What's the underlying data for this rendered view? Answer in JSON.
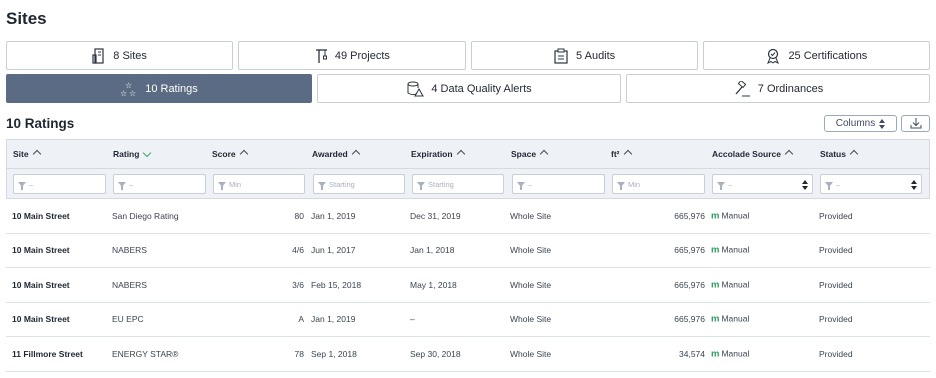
{
  "page": {
    "title": "Sites"
  },
  "tabs_row1": [
    {
      "label": "8 Sites",
      "icon": "building-icon"
    },
    {
      "label": "49 Projects",
      "icon": "crane-icon"
    },
    {
      "label": "5 Audits",
      "icon": "clipboard-icon"
    },
    {
      "label": "25 Certifications",
      "icon": "ribbon-badge-icon"
    }
  ],
  "tabs_row2": [
    {
      "label": "10 Ratings",
      "icon": "stars-icon",
      "active": true
    },
    {
      "label": "4 Data Quality Alerts",
      "icon": "database-alert-icon"
    },
    {
      "label": "7 Ordinances",
      "icon": "gavel-icon"
    }
  ],
  "section": {
    "title": "10 Ratings",
    "columns_label": "Columns"
  },
  "table": {
    "headers": [
      "Site",
      "Rating",
      "Score",
      "Awarded",
      "Expiration",
      "Space",
      "ft²",
      "Accolade Source",
      "Status"
    ],
    "filters": {
      "site": "–",
      "rating": "–",
      "score": "Min",
      "awarded": "Starting",
      "expiration": "Starting",
      "space": "–",
      "ft2": "Min",
      "accolade_source": "–",
      "status": "–"
    },
    "rows": [
      {
        "site": "10 Main Street",
        "rating": "San Diego Rating",
        "score": "80",
        "awarded": "Jan 1, 2019",
        "expiration": "Dec 31, 2019",
        "space": "Whole Site",
        "ft2": "665,976",
        "source": "Manual",
        "status": "Provided"
      },
      {
        "site": "10 Main Street",
        "rating": "NABERS",
        "score": "4/6",
        "awarded": "Jun 1, 2017",
        "expiration": "Jan 1, 2018",
        "space": "Whole Site",
        "ft2": "665,976",
        "source": "Manual",
        "status": "Provided"
      },
      {
        "site": "10 Main Street",
        "rating": "NABERS",
        "score": "3/6",
        "awarded": "Feb 15, 2018",
        "expiration": "May 1, 2018",
        "space": "Whole Site",
        "ft2": "665,976",
        "source": "Manual",
        "status": "Provided"
      },
      {
        "site": "10 Main Street",
        "rating": "EU EPC",
        "score": "A",
        "awarded": "Jan 1, 2019",
        "expiration": "–",
        "space": "Whole Site",
        "ft2": "665,976",
        "source": "Manual",
        "status": "Provided"
      },
      {
        "site": "11 Fillmore Street",
        "rating": "ENERGY STAR®",
        "score": "78",
        "awarded": "Sep 1, 2018",
        "expiration": "Sep 30, 2018",
        "space": "Whole Site",
        "ft2": "34,574",
        "source": "Manual",
        "status": "Provided"
      }
    ],
    "source_glyph": "m"
  },
  "colors": {
    "active_tab": "#5b6b83",
    "accent_green": "#2e9e5d",
    "header_bg": "#eef1f6"
  }
}
